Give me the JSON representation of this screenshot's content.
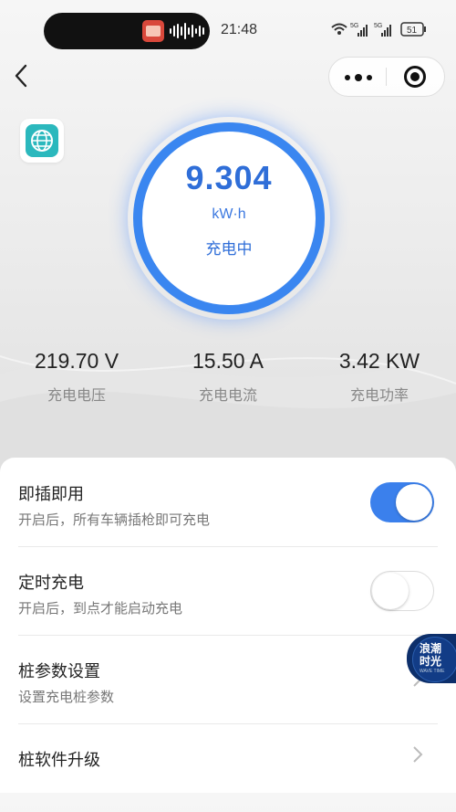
{
  "status_bar": {
    "time": "21:48",
    "battery": "51",
    "network_1": "5G",
    "network_2": "5G"
  },
  "nav": {
    "back_icon": "chevron-left-icon",
    "more_icon": "more-dots-icon",
    "close_icon": "target-close-icon"
  },
  "gauge": {
    "value": "9.304",
    "unit": "kW·h",
    "status": "充电中",
    "accent": "#3a86f0"
  },
  "stats": [
    {
      "value": "219.70 V",
      "label": "充电电压"
    },
    {
      "value": "15.50 A",
      "label": "充电电流"
    },
    {
      "value": "3.42 KW",
      "label": "充电功率"
    }
  ],
  "settings": [
    {
      "title": "即插即用",
      "subtitle": "开启后，所有车辆插枪即可充电",
      "control": "toggle",
      "on": true
    },
    {
      "title": "定时充电",
      "subtitle": "开启后，到点才能启动充电",
      "control": "toggle",
      "on": false
    },
    {
      "title": "桩参数设置",
      "subtitle": "设置充电桩参数",
      "control": "chevron"
    },
    {
      "title": "桩软件升级",
      "subtitle": "",
      "control": "chevron"
    }
  ],
  "floating_badge": {
    "line1": "浪潮",
    "line2": "时光",
    "line3": "WAVE TIME"
  }
}
